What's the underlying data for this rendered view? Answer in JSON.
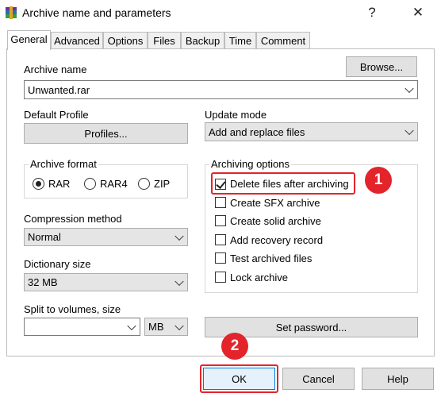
{
  "window": {
    "title": "Archive name and parameters",
    "help_glyph": "?",
    "close_glyph": "✕"
  },
  "tabs": [
    "General",
    "Advanced",
    "Options",
    "Files",
    "Backup",
    "Time",
    "Comment"
  ],
  "general": {
    "archive_name_label": "Archive name",
    "archive_name_value": "Unwanted.rar",
    "browse_label": "Browse...",
    "default_profile_label": "Default Profile",
    "profiles_label": "Profiles...",
    "update_mode_label": "Update mode",
    "update_mode_value": "Add and replace files",
    "archive_format_label": "Archive format",
    "formats": [
      "RAR",
      "RAR4",
      "ZIP"
    ],
    "selected_format": "RAR",
    "compression_method_label": "Compression method",
    "compression_method_value": "Normal",
    "dictionary_size_label": "Dictionary size",
    "dictionary_size_value": "32 MB",
    "split_label": "Split to volumes, size",
    "split_value": "",
    "split_unit": "MB",
    "archiving_options_label": "Archiving options",
    "options": [
      {
        "label": "Delete files after archiving",
        "checked": true
      },
      {
        "label": "Create SFX archive",
        "checked": false
      },
      {
        "label": "Create solid archive",
        "checked": false
      },
      {
        "label": "Add recovery record",
        "checked": false
      },
      {
        "label": "Test archived files",
        "checked": false
      },
      {
        "label": "Lock archive",
        "checked": false
      }
    ],
    "set_password_label": "Set password..."
  },
  "footer": {
    "ok_label": "OK",
    "cancel_label": "Cancel",
    "help_label": "Help"
  },
  "annotations": {
    "callout_1": "1",
    "callout_2": "2",
    "color": "#e3242b"
  }
}
